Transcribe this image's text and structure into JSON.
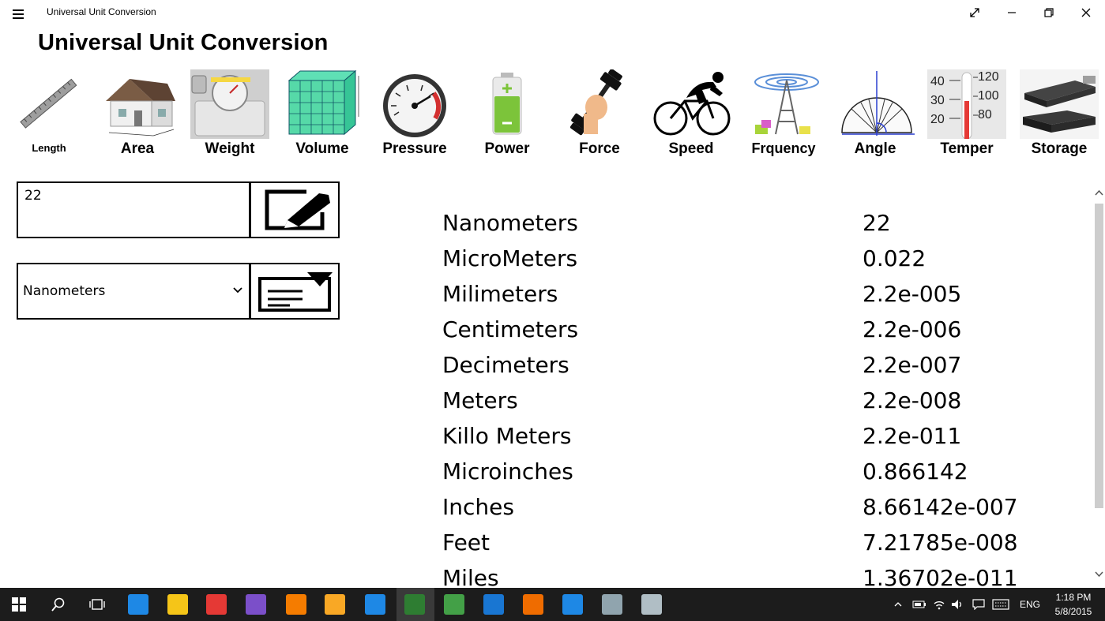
{
  "window": {
    "title": "Universal Unit Conversion"
  },
  "page": {
    "title": "Universal Unit Conversion"
  },
  "categories": [
    {
      "label": "Length",
      "icon": "ruler-icon"
    },
    {
      "label": "Area",
      "icon": "house-icon"
    },
    {
      "label": "Weight",
      "icon": "scale-icon"
    },
    {
      "label": "Volume",
      "icon": "cube-icon"
    },
    {
      "label": "Pressure",
      "icon": "gauge-icon"
    },
    {
      "label": "Power",
      "icon": "battery-icon"
    },
    {
      "label": "Force",
      "icon": "dumbbell-icon"
    },
    {
      "label": "Speed",
      "icon": "cyclist-icon"
    },
    {
      "label": "Frquency",
      "icon": "antenna-icon"
    },
    {
      "label": "Angle",
      "icon": "protractor-icon"
    },
    {
      "label": "Temper",
      "icon": "thermometer-icon"
    },
    {
      "label": "Storage",
      "icon": "usb-drive-icon"
    }
  ],
  "input": {
    "value": "22"
  },
  "unit_select": {
    "selected": "Nanometers"
  },
  "results": [
    {
      "unit": "Nanometers",
      "value": "22"
    },
    {
      "unit": "MicroMeters",
      "value": "0.022"
    },
    {
      "unit": "Milimeters",
      "value": "2.2e-005"
    },
    {
      "unit": "Centimeters",
      "value": "2.2e-006"
    },
    {
      "unit": "Decimeters",
      "value": "2.2e-007"
    },
    {
      "unit": "Meters",
      "value": "2.2e-008"
    },
    {
      "unit": "Killo Meters",
      "value": "2.2e-011"
    },
    {
      "unit": "Microinches",
      "value": "0.866142"
    },
    {
      "unit": "Inches",
      "value": "8.66142e-007"
    },
    {
      "unit": "Feet",
      "value": "7.21785e-008"
    },
    {
      "unit": "Miles",
      "value": "1.36702e-011"
    }
  ],
  "taskbar": {
    "language": "ENG",
    "time": "1:18 PM",
    "date": "5/8/2015",
    "apps": [
      {
        "name": "internet-explorer-icon",
        "color": "#1e88e5"
      },
      {
        "name": "file-explorer-icon",
        "color": "#f5c518"
      },
      {
        "name": "chrome-icon",
        "color": "#e53935"
      },
      {
        "name": "visual-studio-icon",
        "color": "#7b4fc9"
      },
      {
        "name": "app-orange-icon",
        "color": "#f57c00"
      },
      {
        "name": "video-app-icon",
        "color": "#f9a825"
      },
      {
        "name": "music-app-icon",
        "color": "#1e88e5"
      },
      {
        "name": "unit-conversion-app-icon",
        "color": "#2e7d32"
      },
      {
        "name": "utorrent-icon",
        "color": "#43a047"
      },
      {
        "name": "mail-icon",
        "color": "#1976d2"
      },
      {
        "name": "firefox-icon",
        "color": "#ef6c00"
      },
      {
        "name": "store-icon",
        "color": "#1e88e5"
      },
      {
        "name": "image-viewer-icon",
        "color": "#90a4ae"
      },
      {
        "name": "paint-icon",
        "color": "#b0bec5"
      }
    ]
  }
}
